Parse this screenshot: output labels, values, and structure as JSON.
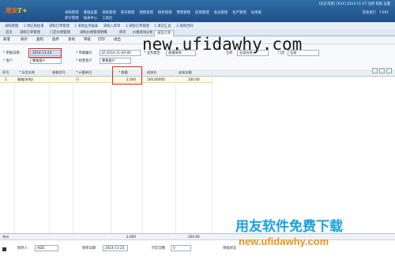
{
  "app": {
    "logo_part1": "用友",
    "logo_part2": "T+",
    "top_info": "[北京华南] [XXX] 2014-11-27  注销  帮助  设置  ",
    "top_menu": [
      "采购管理",
      "基础设置",
      "采购管理",
      "库存管理",
      "销售管理",
      "财务管理",
      "零售管理",
      "促销管理",
      "会员管理",
      "生产管理",
      "往来账"
    ],
    "top_menu2": [
      "库存管理",
      "报表中心",
      "工具栏"
    ],
    "top_right_menu": [
      "资金进行",
      "T-001"
    ]
  },
  "nav": {
    "items": [
      "采购管理",
      "1 供应商往来",
      "采购订单管理",
      "1 采购业务报表",
      "采购入库单",
      "3 采购订单管理",
      "1 进货汇总",
      "2 采购合同"
    ]
  },
  "tabs": {
    "items": [
      "首页",
      "采购订单管理",
      "门店价格管理",
      "采购价格管理明细",
      "库存",
      "价格查询分析",
      "进货订单"
    ]
  },
  "toolbar": {
    "items": [
      "新增",
      "保存",
      "复制",
      "放弃",
      "查询",
      "审核",
      "打印",
      "退出"
    ]
  },
  "form": {
    "date_label": "* 单据日期",
    "date_value": "2014-11-23",
    "code_label": "* 单据编号",
    "code_value": "JZ-2014-11-00-00",
    "biztype_label": "* 业务类型",
    "biztype_value": "普通采购",
    "warehouse_label": "仓库",
    "warehouse_value": "总部仓库",
    "store_label": "门店",
    "store_value": "总部",
    "customer_label": "* 客户",
    "customer_value": "零售客户",
    "handler_label": "* 经营客户",
    "handler_value": "零售客户"
  },
  "grid": {
    "headers": [
      "序号",
      "* 存货名称",
      "规格型号",
      "* 计量单位",
      "* 数量",
      "成本价",
      "成本金额"
    ],
    "row": {
      "no": "1",
      "name": "钢笔(外购)",
      "spec": "",
      "unit": "只",
      "qty": "2.000",
      "price": "100.00000",
      "amount": "200.00"
    },
    "totals": {
      "label": "合计",
      "qty": "2.000",
      "amount": "200.00"
    }
  },
  "footer": {
    "maker_label": "制单人",
    "maker_value": "ADD",
    "date_label": "制单日期",
    "date_value": "2014-11-23",
    "print_label": "打印次数",
    "print_value": "0",
    "audit_label": "审核状态"
  },
  "watermark": {
    "url_top": "new.ufidawhy.com",
    "title_cn": "用友软件免费下载",
    "url_bottom": "new.ufidawhy.com"
  },
  "colors": {
    "banner": "#2f6ea8",
    "highlight": "#e0261b",
    "row_bg": "#fffbe0"
  }
}
